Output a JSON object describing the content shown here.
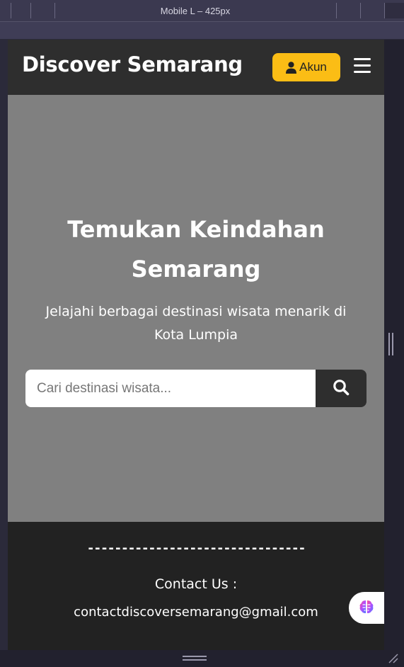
{
  "devtools": {
    "device_label": "Mobile L – 425px"
  },
  "navbar": {
    "brand": "Discover Semarang",
    "account_label": "Akun",
    "account_icon": "user-icon",
    "menu_icon": "hamburger-menu-icon"
  },
  "hero": {
    "title": "Temukan Keindahan Semarang",
    "subtitle": "Jelajahi berbagai destinasi wisata menarik di Kota Lumpia",
    "search": {
      "placeholder": "Cari destinasi wisata...",
      "value": "",
      "icon": "search-icon"
    }
  },
  "footer": {
    "divider": "--------------------------------",
    "contact_title": "Contact Us :",
    "contact_email": "contactdiscoversemarang@gmail.com"
  },
  "widget": {
    "icon": "brain-icon"
  },
  "colors": {
    "navbar_bg": "#2e2e2e",
    "accent": "#fbbd15",
    "hero_bg": "#808080",
    "footer_bg": "#222222"
  }
}
